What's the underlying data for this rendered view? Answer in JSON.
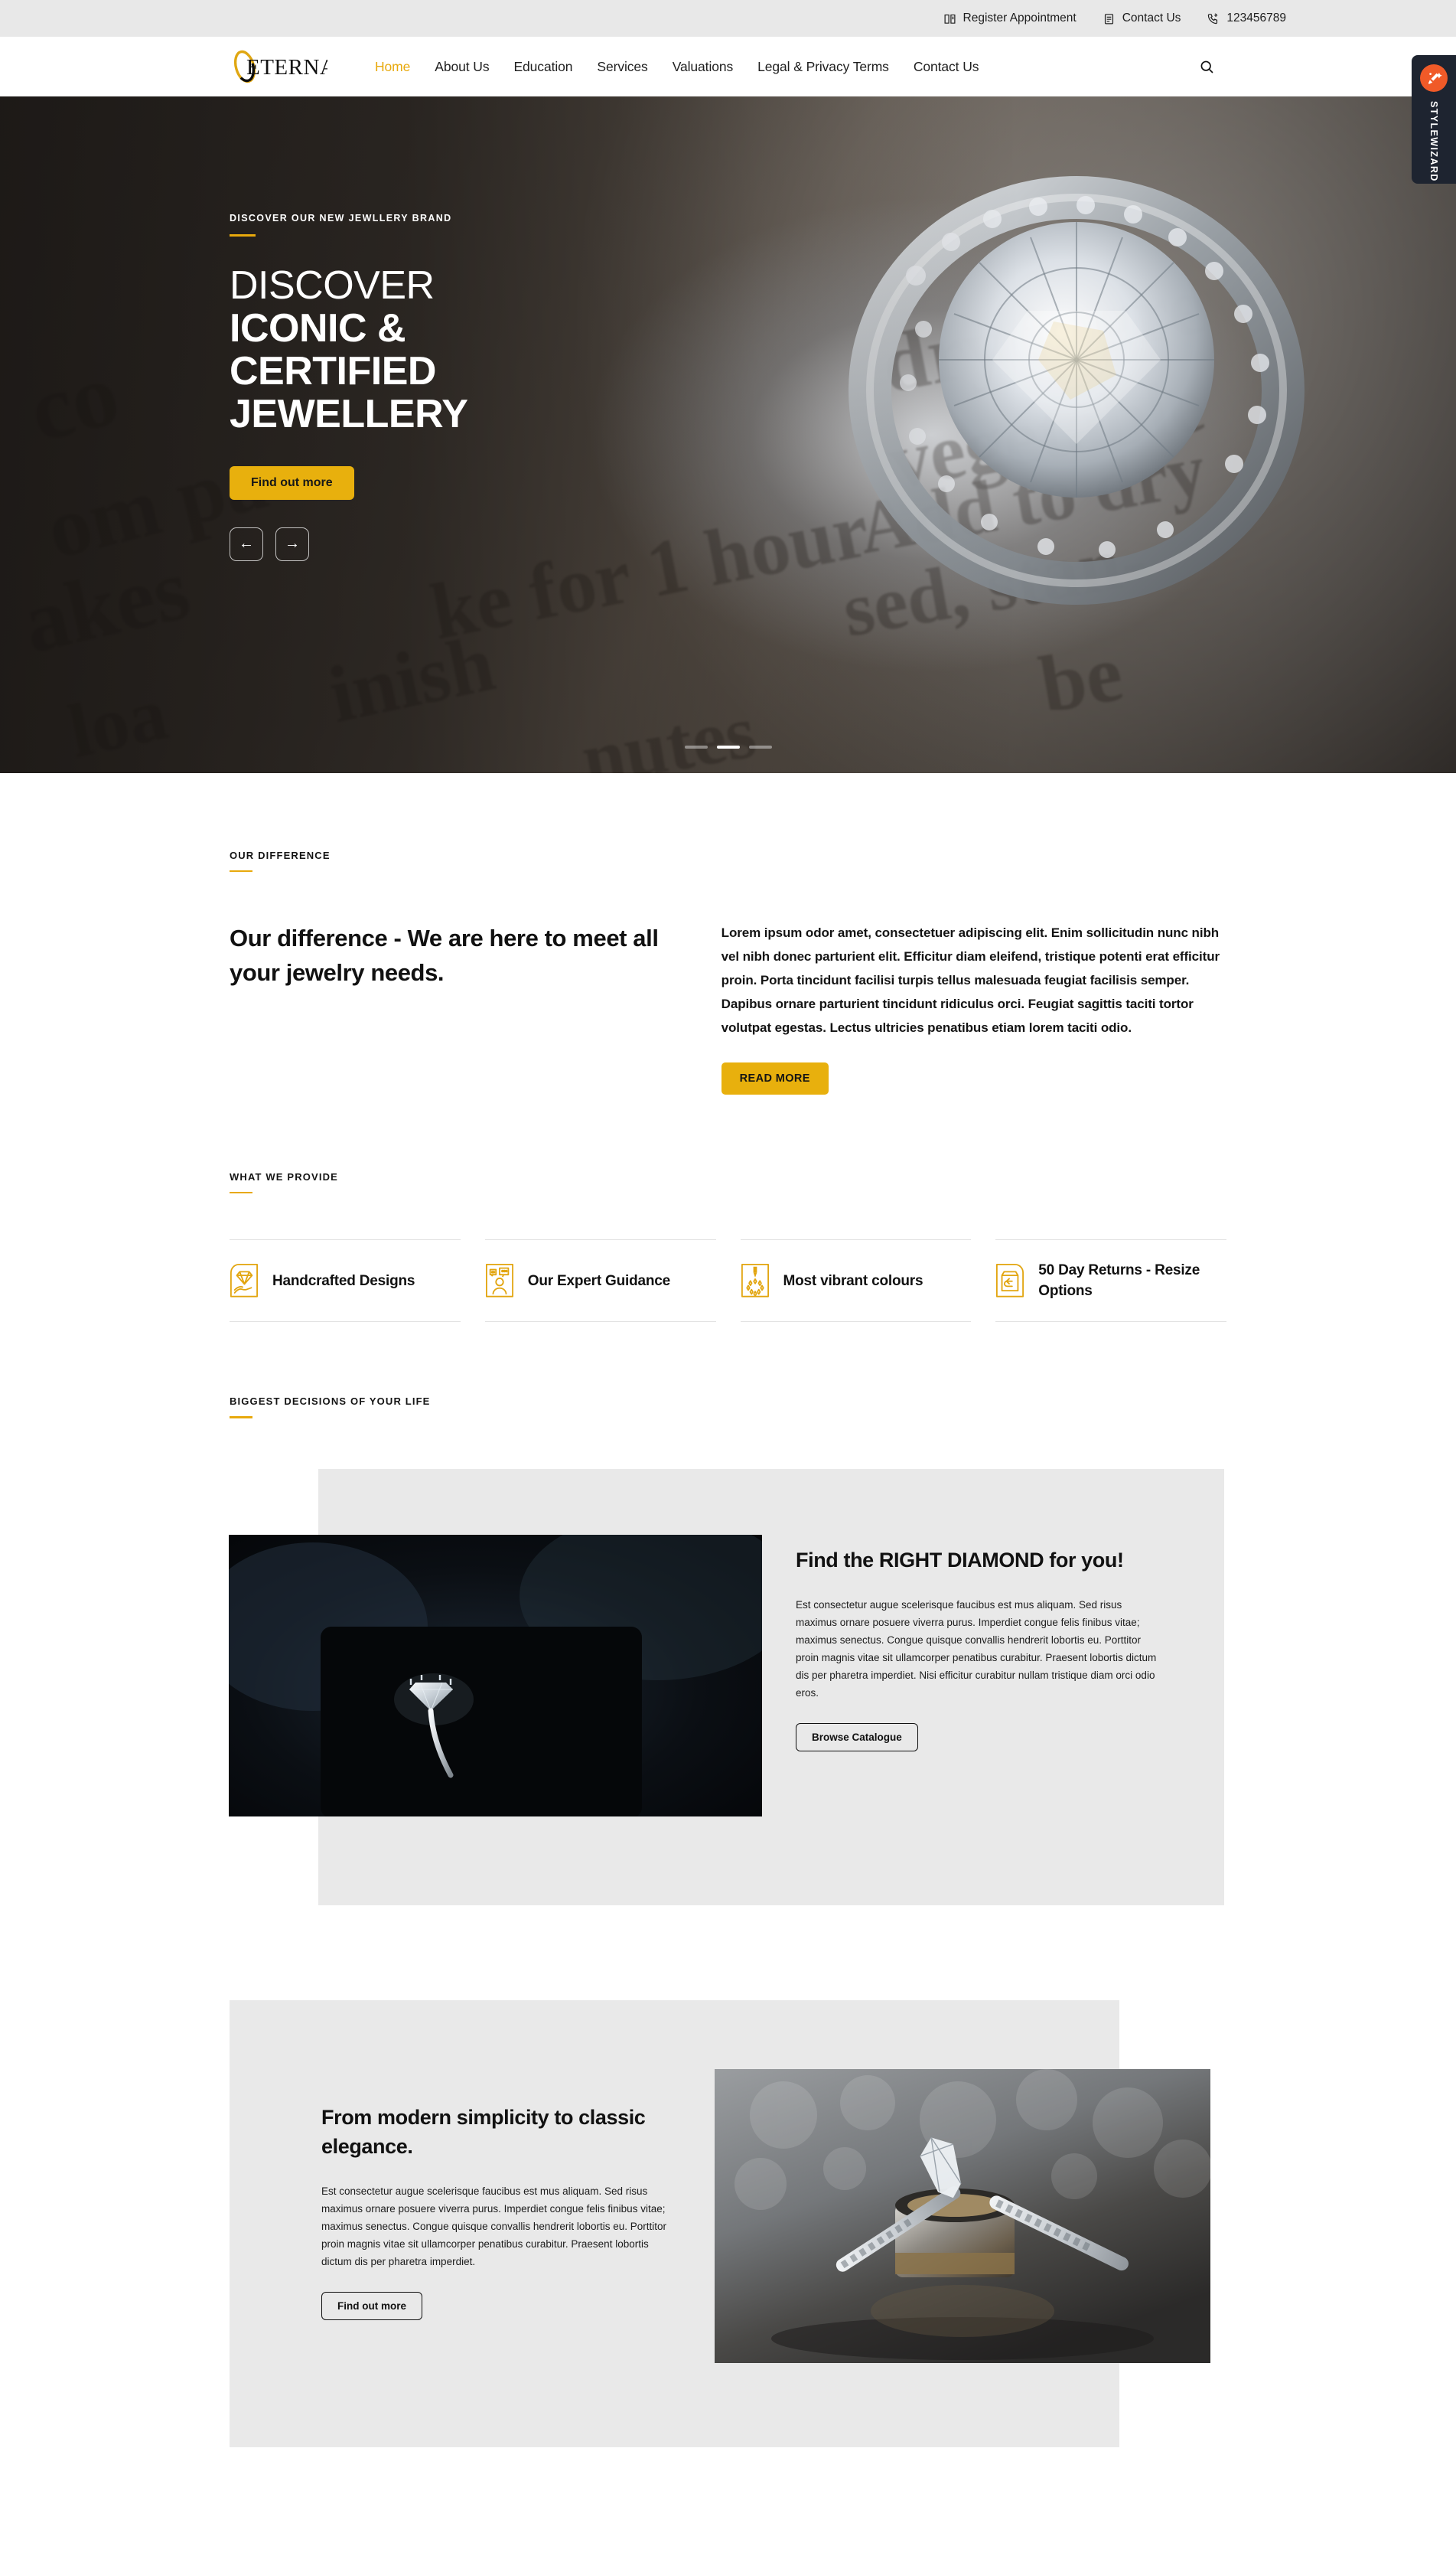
{
  "topbar": {
    "items": [
      {
        "label": "Register Appointment",
        "icon": "book-icon"
      },
      {
        "label": "Contact Us",
        "icon": "clipboard-icon"
      },
      {
        "label": "123456789",
        "icon": "phone-icon"
      }
    ]
  },
  "header": {
    "logo_text": "ETERNAL",
    "nav": [
      {
        "label": "Home",
        "active": true
      },
      {
        "label": "About Us",
        "active": false
      },
      {
        "label": "Education",
        "active": false
      },
      {
        "label": "Services",
        "active": false
      },
      {
        "label": "Valuations",
        "active": false
      },
      {
        "label": "Legal & Privacy Terms",
        "active": false
      },
      {
        "label": "Contact Us",
        "active": false
      }
    ],
    "search_icon": "search-icon"
  },
  "stylewizard": {
    "label": "STYLEWIZARD",
    "badge_icon": "magic-wand-icon",
    "badge_color": "#f05a28",
    "panel_color": "#1e2430"
  },
  "hero": {
    "eyebrow": "DISCOVER OUR NEW JEWLLERY BRAND",
    "title_line1": "DISCOVER",
    "title_line2": "ICONIC &",
    "title_line3": "CERTIFIED",
    "title_line4": "JEWELLERY",
    "cta": "Find out more",
    "prev_icon": "arrow-left-icon",
    "next_icon": "arrow-right-icon",
    "slides": 3,
    "active_slide": 2
  },
  "difference": {
    "eyebrow": "OUR DIFFERENCE",
    "heading": "Our difference - We are here to meet all your jewelry needs.",
    "paragraph": "Lorem ipsum odor amet, consectetuer adipiscing elit. Enim sollicitudin nunc nibh vel nibh donec parturient elit. Efficitur diam eleifend, tristique potenti erat efficitur proin. Porta tincidunt facilisi turpis tellus malesuada feugiat facilisis semper. Dapibus ornare parturient tincidunt ridiculus orci. Feugiat sagittis taciti tortor volutpat egestas. Lectus ultricies penatibus etiam lorem taciti odio.",
    "cta": "READ MORE"
  },
  "provide": {
    "eyebrow": "WHAT WE PROVIDE",
    "cards": [
      {
        "label": "Handcrafted Designs",
        "icon": "diamond-in-hand-icon"
      },
      {
        "label": "Our Expert Guidance",
        "icon": "person-chat-icon"
      },
      {
        "label": "Most vibrant colours",
        "icon": "colour-palette-icon"
      },
      {
        "label": "50 Day Returns - Resize Options",
        "icon": "return-box-icon"
      }
    ]
  },
  "decisions": {
    "eyebrow": "BIGGEST DECISIONS OF YOUR LIFE",
    "blocks": [
      {
        "heading": "Find the RIGHT DIAMOND for you!",
        "paragraph": "Est consectetur augue scelerisque faucibus est mus aliquam. Sed risus maximus ornare posuere viverra purus. Imperdiet congue felis finibus vitae; maximus senectus. Congue quisque convallis hendrerit lobortis eu. Porttitor proin magnis vitae sit ullamcorper penatibus curabitur. Praesent lobortis dictum dis per pharetra imperdiet. Nisi efficitur curabitur nullam tristique diam orci odio eros.",
        "cta": "Browse Catalogue",
        "image_alt": "solitaire-diamond-ring-in-box"
      },
      {
        "heading": "From modern simplicity to classic elegance.",
        "paragraph": "Est consectetur augue scelerisque faucibus est mus aliquam. Sed risus maximus ornare posuere viverra purus. Imperdiet congue felis finibus vitae; maximus senectus. Congue quisque convallis hendrerit lobortis eu. Porttitor proin magnis vitae sit ullamcorper penatibus curabitur. Praesent lobortis dictum dis per pharetra imperdiet.",
        "cta": "Find out more",
        "image_alt": "wedding-bands-and-engagement-ring"
      }
    ]
  },
  "colors": {
    "gold": "#e8b00d",
    "gold_accent": "#e8a90c",
    "panel_grey": "#e9e9e9",
    "topbar_grey": "#e8e8e8",
    "text": "#111111"
  }
}
